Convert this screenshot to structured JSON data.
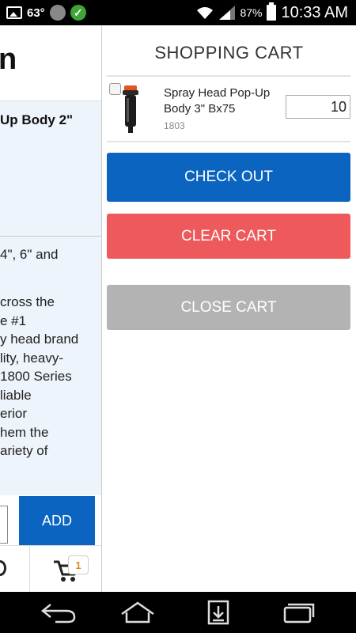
{
  "status_bar": {
    "temperature": "63°",
    "battery_percent": "87%",
    "time": "10:33 AM",
    "icons": [
      "image-icon",
      "weather-circle-icon",
      "check-icon",
      "wifi-icon",
      "signal-icon",
      "battery-icon"
    ]
  },
  "background_page": {
    "logo_fragment": "n",
    "title_fragment": "Up Body 2\"",
    "sizes_fragment": "4\", 6\" and",
    "description_lines": [
      "cross the",
      "e #1",
      "y head brand",
      "lity, heavy-",
      "1800 Series",
      "liable",
      "erior",
      "hem the",
      "ariety of"
    ],
    "add_label": "ADD",
    "cart_badge": "1"
  },
  "cart": {
    "title": "SHOPPING CART",
    "items": [
      {
        "name": "Spray Head Pop-Up Body 3\" Bx75",
        "sku": "1803",
        "quantity": "10",
        "checked": false
      }
    ],
    "checkout_label": "CHECK OUT",
    "clear_label": "CLEAR CART",
    "close_label": "CLOSE CART"
  },
  "colors": {
    "checkout": "#0b64c0",
    "clear": "#ee5a5b",
    "close": "#b3b3b3",
    "badge": "#e08a1e"
  }
}
